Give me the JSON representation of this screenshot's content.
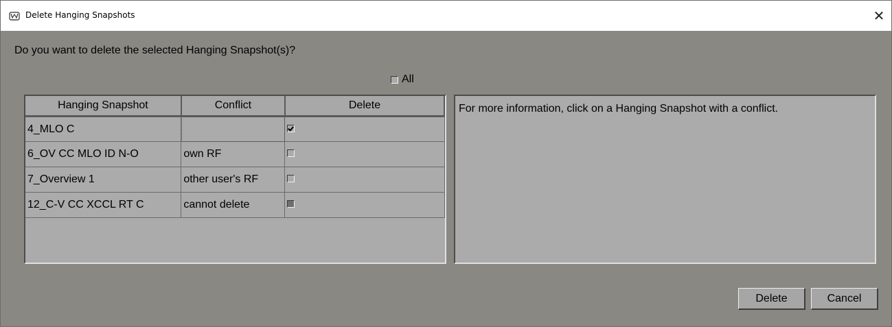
{
  "window": {
    "title": "Delete Hanging Snapshots",
    "close_glyph": "✕",
    "app_icon": "app-shield-icon"
  },
  "dialog": {
    "question": "Do you want to delete the selected Hanging Snapshot(s)?",
    "all_label": "All",
    "all_checked": false,
    "info_text": "For more information, click on a Hanging Snapshot with a conflict."
  },
  "table": {
    "headers": [
      "Hanging Snapshot",
      "Conflict",
      "Delete"
    ],
    "rows": [
      {
        "snapshot": "4_MLO C",
        "conflict": "",
        "delete": "checked"
      },
      {
        "snapshot": "6_OV CC MLO ID N-O",
        "conflict": "own RF",
        "delete": "unchecked"
      },
      {
        "snapshot": "7_Overview 1",
        "conflict": "other user's RF",
        "delete": "unchecked"
      },
      {
        "snapshot": "12_C-V CC XCCL RT C",
        "conflict": "cannot delete",
        "delete": "disabled"
      }
    ]
  },
  "buttons": {
    "delete_label": "Delete",
    "cancel_label": "Cancel"
  },
  "colors": {
    "dialog_bg": "#8a8883",
    "panel_bg": "#ababab",
    "titlebar_bg": "#ffffff"
  }
}
